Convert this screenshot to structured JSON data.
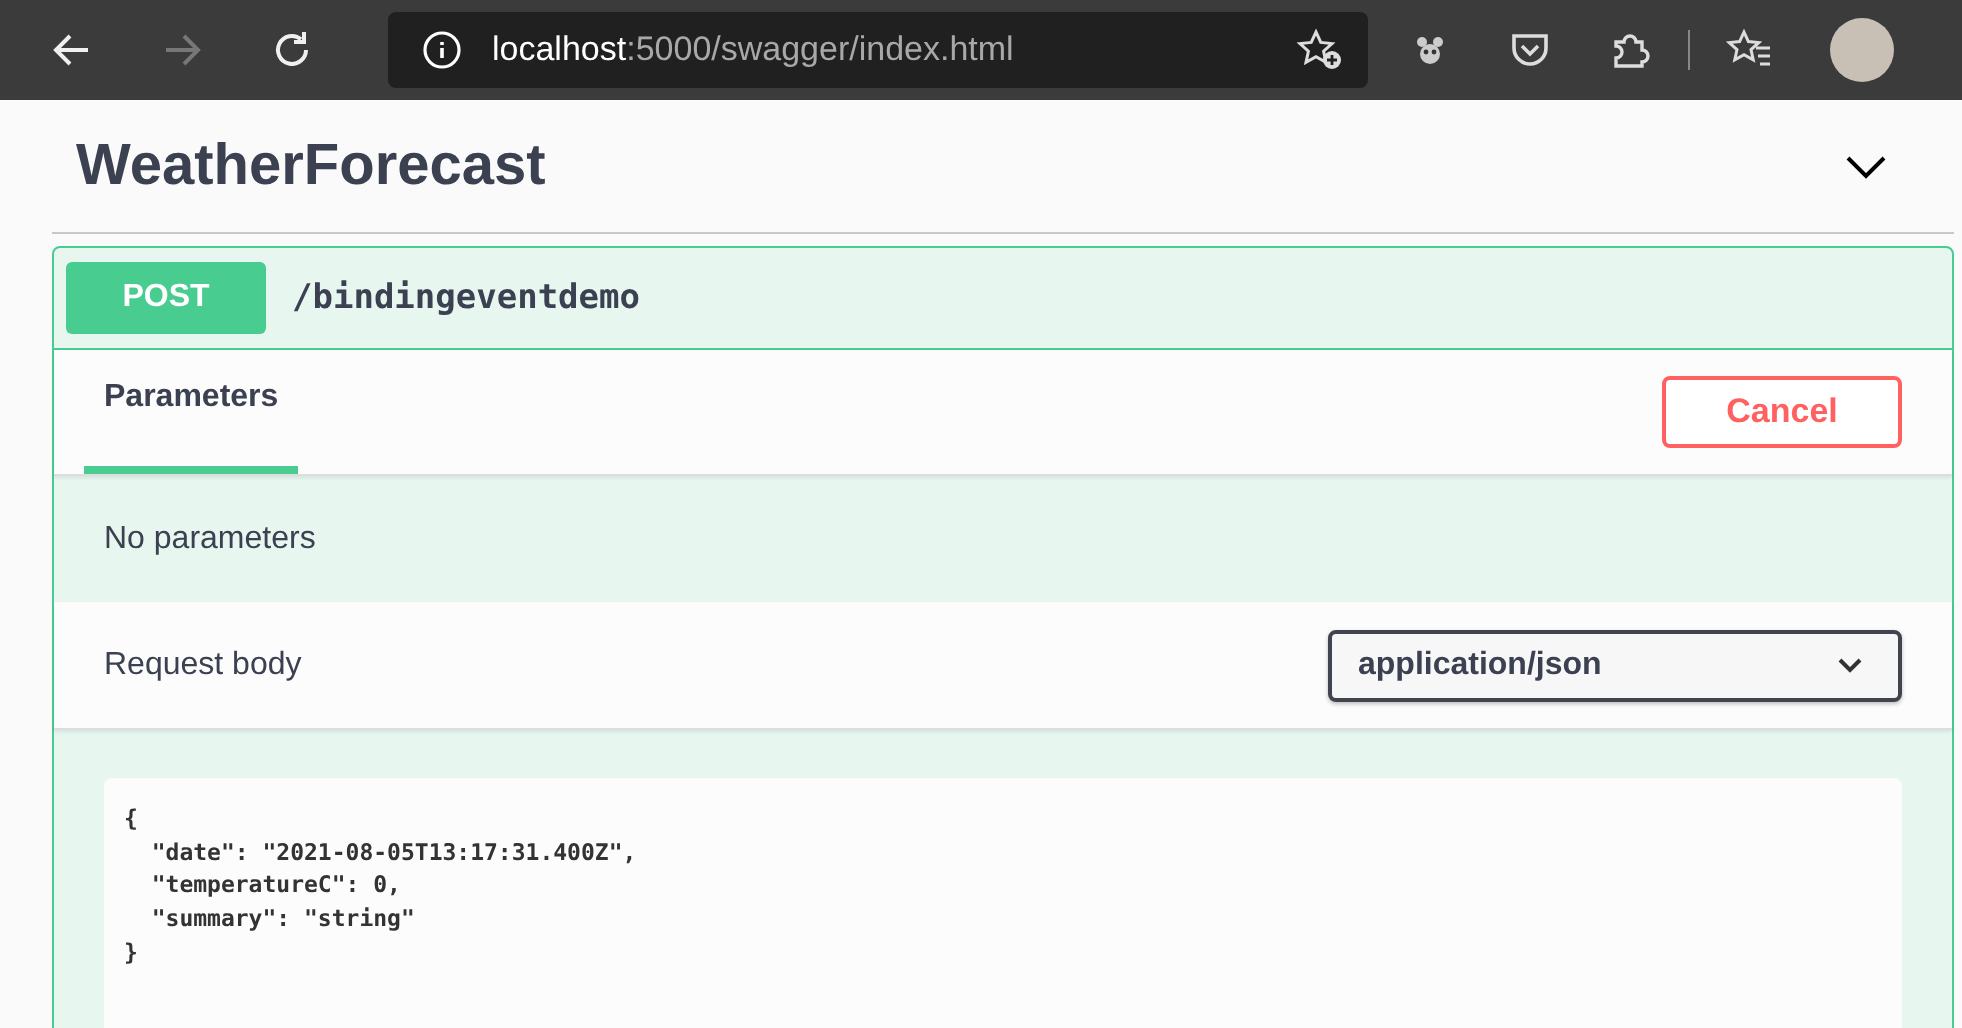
{
  "browser": {
    "nav": [
      {
        "kind": "back",
        "disabled": false
      },
      {
        "kind": "forward",
        "disabled": true
      },
      {
        "kind": "refresh",
        "disabled": false
      }
    ],
    "url": {
      "host": "localhost",
      "path": ":5000/swagger/index.html"
    }
  },
  "section": {
    "title": "WeatherForecast",
    "expanded": true
  },
  "operation": {
    "method": "POST",
    "path": "/bindingeventdemo",
    "tabs": [
      {
        "label": "Parameters",
        "selected": true
      }
    ],
    "cancel_button": "Cancel",
    "parameters_text": "No parameters",
    "request_body": {
      "label": "Request body",
      "content_type": "application/json",
      "example": "{\n  \"date\": \"2021-08-05T13:17:31.400Z\",\n  \"temperatureC\": 0,\n  \"summary\": \"string\"\n}"
    }
  }
}
